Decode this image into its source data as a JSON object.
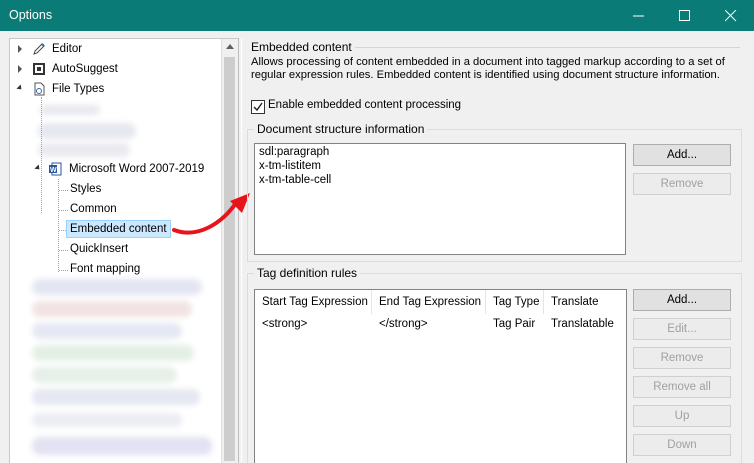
{
  "window": {
    "title": "Options"
  },
  "tree": {
    "top_items": [
      {
        "label": "Editor",
        "icon": "pencil-icon"
      },
      {
        "label": "AutoSuggest",
        "icon": "autosuggest-icon"
      },
      {
        "label": "File Types",
        "icon": "file-types-icon"
      }
    ],
    "word_node": {
      "label": "Microsoft Word 2007-2019",
      "icon": "word-icon"
    },
    "children": [
      "Styles",
      "Common",
      "Embedded content",
      "QuickInsert",
      "Font mapping"
    ],
    "selected": "Embedded content"
  },
  "embedded": {
    "section_title": "Embedded content",
    "description": "Allows processing of content embedded in a document into tagged markup according to a set of regular expression rules. Embedded content is identified using document structure information.",
    "enable_label": "Enable embedded content processing",
    "enable_checked": true
  },
  "structure": {
    "title": "Document structure information",
    "items": [
      "sdl:paragraph",
      "x-tm-listitem",
      "x-tm-table-cell"
    ],
    "add_label": "Add...",
    "remove_label": "Remove"
  },
  "rules": {
    "title": "Tag definition rules",
    "columns": [
      "Start Tag Expression",
      "End Tag Expression",
      "Tag Type",
      "Translate"
    ],
    "rows": [
      [
        "<strong>",
        "</strong>",
        "Tag Pair",
        "Translatable"
      ]
    ],
    "buttons": [
      "Add...",
      "Edit...",
      "Remove",
      "Remove all",
      "Up",
      "Down"
    ]
  },
  "colors": {
    "titlebar": "#0a7b76",
    "arrow": "#e8141c",
    "selection": "#cce8ff"
  }
}
